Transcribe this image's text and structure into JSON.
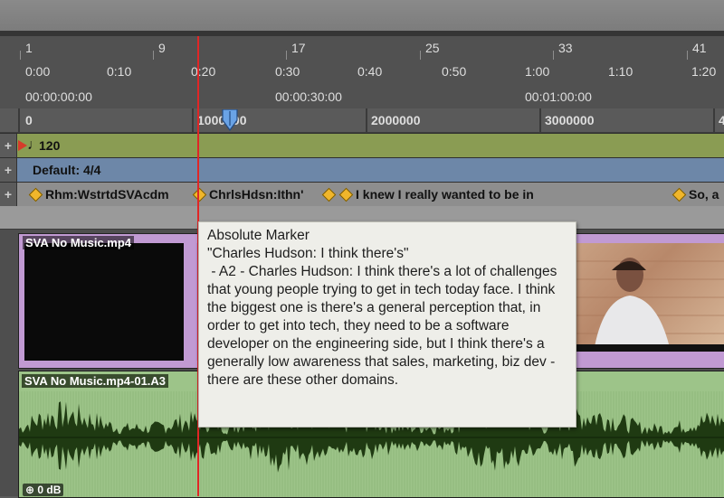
{
  "ruler_bars": [
    "1",
    "9",
    "17",
    "25",
    "33",
    "41"
  ],
  "ruler_minsecs": [
    "0:00",
    "0:10",
    "0:20",
    "0:30",
    "0:40",
    "0:50",
    "1:00",
    "1:10",
    "1:20"
  ],
  "ruler_timecode": [
    "00:00:00:00",
    "00:00:30:00",
    "00:01:00:00"
  ],
  "ruler_samples": [
    "0",
    "1000000",
    "2000000",
    "3000000",
    "4"
  ],
  "tempo": {
    "value": "120",
    "note_glyph": "♩"
  },
  "meter": {
    "label": "Default: 4/4"
  },
  "markers": [
    "Rhm:WstrtdSVAcdm",
    "ChrlsHdsn:Ithn'",
    "",
    "I knew I really wanted to be in",
    "So, a"
  ],
  "tooltip": {
    "line1": "Absolute Marker",
    "line2": "\"Charles Hudson: I think there's\"",
    "body": " - A2 - Charles Hudson: I think there's a lot of challenges that young people trying to get in tech today face. I think the biggest one is there's a general perception that, in order to get into tech, they need to be a software developer on the engineering side, but I think there's a generally low awareness that sales, marketing, biz dev - there are these other domains."
  },
  "video_clip": {
    "name": "SVA No Music.mp4"
  },
  "audio_clip": {
    "name": "SVA No Music.mp4-01.A3",
    "gain": "0 dB"
  },
  "plus_glyph": "+",
  "colors": {
    "tempo_row": "#8a9c53",
    "meter_row": "#6d87a8",
    "marker_diamond": "#f0b62b",
    "playhead": "#e02626",
    "video_clip": "#c19ad3",
    "audio_clip": "#9dc489",
    "waveform": "#1f3a12"
  }
}
